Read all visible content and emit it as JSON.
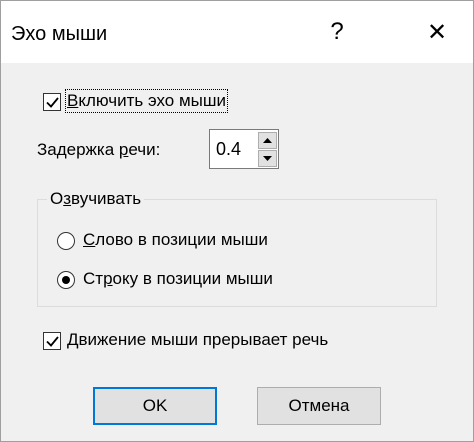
{
  "dialog": {
    "title": "Эхо мыши",
    "help_glyph": "?",
    "close_glyph": "✕"
  },
  "enable_echo": {
    "checked": true,
    "label_accel": "В",
    "label_rest": "ключить эхо мыши"
  },
  "delay": {
    "label_pre": "Задержка ",
    "label_accel": "р",
    "label_post": "ечи:",
    "value": "0.4"
  },
  "voice_group": {
    "title_pre": "О",
    "title_accel": "з",
    "title_post": "вучивать",
    "options": [
      {
        "selected": false,
        "accel": "С",
        "rest": "лово в позиции мыши"
      },
      {
        "selected": true,
        "pre": "Ст",
        "accel": "р",
        "rest": "оку в позиции мыши"
      }
    ]
  },
  "interrupt": {
    "checked": true,
    "label_accel": "Д",
    "label_rest": "вижение мыши прерывает речь"
  },
  "buttons": {
    "ok_label": "OK",
    "cancel_label": "Отмена"
  },
  "colors": {
    "accent": "#0078d7",
    "dialog_bg": "#f0f0f0"
  },
  "icons": {
    "help": "question-mark-icon",
    "close": "close-x-icon",
    "spin_up": "triangle-up-icon",
    "spin_down": "triangle-down-icon"
  }
}
